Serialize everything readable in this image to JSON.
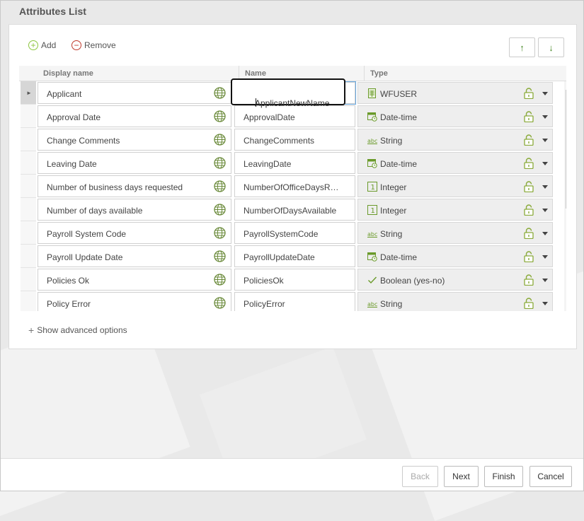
{
  "page": {
    "title": "Attributes List"
  },
  "toolbar": {
    "add_label": "Add",
    "remove_label": "Remove",
    "move_up_icon": "arrow-up",
    "move_down_icon": "arrow-down",
    "move_up_glyph": "↑",
    "move_down_glyph": "↓"
  },
  "grid": {
    "columns": [
      "Display name",
      "Name",
      "Type"
    ],
    "rows": [
      {
        "display": "Applicant",
        "name": "ApplicantNewName",
        "type": "WFUSER",
        "type_icon": "user-table-icon",
        "editing": true,
        "selected": true
      },
      {
        "display": "Approval Date",
        "name": "ApprovalDate",
        "type": "Date-time",
        "type_icon": "calendar-icon"
      },
      {
        "display": "Change Comments",
        "name": "ChangeComments",
        "type": "String",
        "type_icon": "abc-icon"
      },
      {
        "display": "Leaving Date",
        "name": "LeavingDate",
        "type": "Date-time",
        "type_icon": "calendar-icon"
      },
      {
        "display": "Number of business days requested",
        "name": "NumberOfOfficeDaysR…",
        "type": "Integer",
        "type_icon": "integer-icon"
      },
      {
        "display": "Number of days available",
        "name": "NumberOfDaysAvailable",
        "type": "Integer",
        "type_icon": "integer-icon"
      },
      {
        "display": "Payroll System Code",
        "name": "PayrollSystemCode",
        "type": "String",
        "type_icon": "abc-icon"
      },
      {
        "display": "Payroll Update Date",
        "name": "PayrollUpdateDate",
        "type": "Date-time",
        "type_icon": "calendar-icon"
      },
      {
        "display": "Policies Ok",
        "name": "PoliciesOk",
        "type": "Boolean (yes-no)",
        "type_icon": "check-icon"
      },
      {
        "display": "Policy Error",
        "name": "PolicyError",
        "type": "String",
        "type_icon": "abc-icon"
      }
    ]
  },
  "advanced": {
    "label": "Show advanced options"
  },
  "footer": {
    "back": "Back",
    "next": "Next",
    "finish": "Finish",
    "cancel": "Cancel"
  },
  "colors": {
    "accent_green": "#8dc63f",
    "remove_red": "#c0392b",
    "icon_green": "#6a9a2a"
  }
}
